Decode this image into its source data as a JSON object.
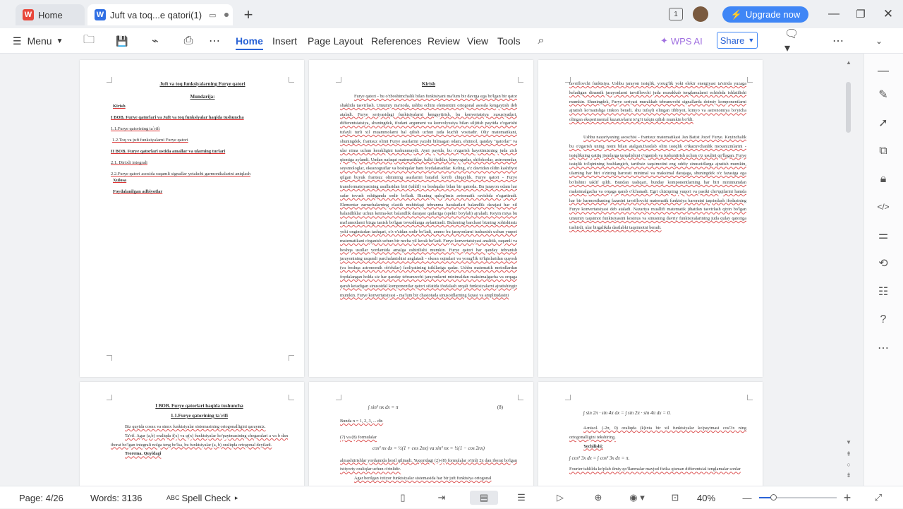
{
  "tabs": {
    "home_label": "Home",
    "doc_label": "Juft va toq...e qatori(1)"
  },
  "titlebar": {
    "upgrade_label": "Upgrade now"
  },
  "ribbon": {
    "menu_label": "Menu",
    "items": [
      "Home",
      "Insert",
      "Page Layout",
      "References",
      "Review",
      "View",
      "Tools"
    ],
    "wps_ai_label": "WPS AI",
    "share_label": "Share"
  },
  "page1": {
    "title": "Juft va toq funksiyalarning Furye qatori",
    "subtitle": "Mundarija:",
    "toc": [
      "Kirish",
      "I BOB. Furye qatorlari va Juft va toq funksiyalar haqida tushuncha",
      "1.1.Furye qatorining ta`rifi",
      "1.2.Toq va juft funksiyalarni Furye qatori",
      "II BOB. Furye qatorlari ustida amallar va ularning turlari",
      "2.1. Dirixli integrali",
      "2.2.Furye qatori asosida raqamli signallar yetakchi garmonikalarini aniqlash",
      "Xulosa",
      "Foydalanilgan adbiyotlar"
    ]
  },
  "page2": {
    "title": "Kirish",
    "text": "Furye qatori - bu o'zboshimchalik bilan funktsiyani ma'lum bir davrga ega bo'lgan bir qator shaklida tasvirlash. Umumiy ma'noda, ushbu echim elementini ortogonal asosda kengaytish deb ataladi. Furye seriyasidagi funktsiyalarni kengaytirish, bu konvertatsiya xususiyatlari, differentsiatsiya, shuningdek, ifodani argument va konvolyusiya bilan siljitish paytida o'zgarishi tufayli turli xil muammolarni hal qilish uchun juda kuchli vositadir. Oliy matematikani, shuningdek, frantsuz olimi Furye asarlarini yaxshi bilmagan odam, ehtimol, qanday \"qatorlar\" va ular nima uchun kerakligini tushunmaydi. Ayni paytda, bu o'zgarish hayotimizning juda zich qismiga aylandi. Undan nafaqat matematiklar, balki fiziklar, kimyogarlar, shifokorlar, astronomlar, seysmologlar, okeanograflar va boshqalar ham foydalanadilar. Keling, o'z davridan oldin kashfiyot qilgan buyuk frantsuz olimining asarlarini batafsil ko'rib chiqaylik. Furye qatori - Furye transformatsiyasining usullaridan biri (tahlil) va boshqalar bilan bir qatorda. Bu jarayon odam har safar tovush eshitganda sodir bo'ladi. Bizning qulog'imiz avtomatik ravishda o'zgartiradi. Elementar zarrachalarning elastik muhitdagi tebranma harakatlari balandlik darajasi har xil balandliklar uchun ketma-ket balandlik darajasi qatlariga (spektr bo'ylab) ajraladi. Keyin miya bu ma'lumotlarni bizga tanish bo'lgan tovushlarga aylantiradi. Bularning barchasi bizning xohishimiz yoki ongimizdan tashqari, o'z-o'zidan sodir bo'ladi, ammo bu jarayonlarni tushunish uchun yuqori matematikani o'rganish uchun bir necha yil kerak bo'ladi. Furye konvertatsiyasi analitik, raqamli va boshqa usullar yordamida amalga oshirilishi mumkin. Furye qatori har qanday tebranish jarayonining raqamli parchalanishini anglatadi - okean oqimlari va yorug'lik to'lqinlaridan quyosh (va boshqa astronomik ob'ektlar) faoliyatining tsikllariga qadar. Ushbu matematik metodlardan foydalangan holda siz har qanday tebranuvchi jarayonlarni minimaldan maksimalgacha va orqaga qarab ketadigan sinusoidal komponentlar qatori sifatida ifodalash orqali funktsiyalarni ajratishingiz mumkin. Furye konvertatsiyasi - ma'lum bir chastotada sinusoidlarning fazasi va amplitudasini"
  },
  "page3": {
    "text1": "tavsiflovchi funktsiya. Ushbu jarayon issiqlik, yorug'lik yoki elektr energiyasi ta'sirida yuzaga keladigan dinamik jarayonlarni tavsiflovchi juda murakkab tenglamalarni echishda ishlatilishi mumkin. Shuningdek, Furye seriyasi murakkab tebranuvchi signallarda doimiy komponentlarni ajratish ko'rsatishga imkon beradi, shu tufayli olingan tibbiyot, kimyo va astronomiya bo'yicha olingan eksperimental kuzatuvlarni to'g'ri talqin qilish mumkin bo'ldi.",
    "text2": "Ushbu nazariyaning asoschisi - frantsuz matematikasi Jan Batist Jozef Furye. Keyinchalik bu o'zgarish uning nomi bilan atalgan.Dastlab olim issiqlik o'tkazuvchanlik mexanizmlarini - issiqlikning qattiq jismlarga tarqalishini o'rganish va tushuntirish uchun o'z usulini qo'llagan. Furye issiqlik to'lqinining boshlangich, tartibsiz taqsimotini eng oddiy sinusoidlarga ajratish mumkin, ularning har biri o'zining harorati minimal va maksimal darajaga, shuningdek o'z fazasiga ega bo'lishini taklif qildi. Bundan tashqari, bunday komponentlarning har biri minimumdan maksimalgacha va orqaga qarab o'lchanadi. Egri chiziqning yuqori va pastki cho'qqilarini hamda har bir harmonikaning fazasini tavsiflovchi matematik funktsiya haroratni taqsimlash ifodasining Furye konvertatsiyasi deb ataladi. Nazariya muallifi matematik jihatdan tasvirlash qiyin bo'lgan umumiy taqsimot funktsiyasini kosinus va sinusning davriy funktsiyalarining juda qulay qatoriga tushirdi, ular birgalikda dastlabki taqsimotni beradi."
  },
  "page4": {
    "title": "I BOB. Furye qatorlari haqida tushuncha",
    "subtitle": "1.1.Furye qatorining ta`rifi",
    "text": "Biz quyida cosnx va sinnx funktsiyalar sistemasining ortogonalligini qaraymiz.",
    "tarif": "Ta'rif. Agar (a,b) oraliqda f(x) va φ(x) funktsiyalar ko'paytmasining chegaralari a va b dan iborat bo'lgan integrali nolga teng bo'lsa, bu funktsiyalar (a, b) oraliqda ortogonal deyiladi.",
    "teorema": "Teorema. Quyidagi"
  },
  "page5": {
    "formula1": "∫ sin² nx dx = π",
    "eq_num": "(8)",
    "bunda": "Bunda n = 1, 2, 3, ... dir.",
    "formulalar": "(7) va (8) formulalar",
    "formula2": "cos² nx dx = ½(1 + cos 2nx)     va     sin² nx = ½(1 − cos 2nx)",
    "text": "almashtirishlar yordamida hosil qilinadi. Yuqoridagi (2)-(8) formulalar o'rinli 2π dan iborat bo'lgan ixtiyoriy oraliqlar uchun o'rinlidir.",
    "text2": "Agar berilgan ixtiyor funktsiyalar sistemasida har bir juft funktsiya ortogonal"
  },
  "page6": {
    "formula1": "∫ sin 2π · sin 4π dx = ∫ sin 2π · sin 4π dx = 0.",
    "misol": "4-misol. (-2π, 0) oraliqda (k)ixta bir xil funktsiyalar ko'paytmasi cos²3x ning ortogonalligini tekshiring.",
    "yechish": "Yechilishi:",
    "formula2": "∫ cos² 3x dx = ∫ cos² 3x dx = π.",
    "text": "Fourier tahlilda ko'plab ilmiy qo'llanmalar mavjud fizika qisman differentsial tenglamalar sonlar"
  },
  "statusbar": {
    "page_label": "Page: 4/26",
    "words_label": "Words: 3136",
    "spell_label": "Spell Check",
    "zoom_label": "40%"
  },
  "colors": {
    "accent": "#2a63d6",
    "upgrade": "#3f86f6",
    "wps_logo": "#e8473b",
    "doc_logo": "#2f6fe4"
  }
}
